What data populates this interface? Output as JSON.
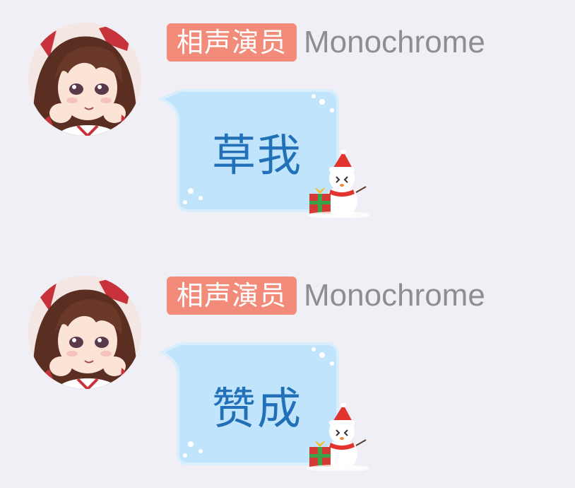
{
  "theme": {
    "background": "#efeff5",
    "badge_color": "#f28b79",
    "bubble_fill": "#bfe4fb",
    "bubble_stroke": "#d8eefc",
    "text_color": "#2271b8",
    "name_color": "#8d8e94"
  },
  "messages": [
    {
      "sender_title": "相声演员",
      "sender_name": "Monochrome",
      "text": "草我",
      "avatar_icon": "anime-girl-avatar-icon",
      "bubble_decoration_icon": "snowman-gift-icon"
    },
    {
      "sender_title": "相声演员",
      "sender_name": "Monochrome",
      "text": "赞成",
      "avatar_icon": "anime-girl-avatar-icon",
      "bubble_decoration_icon": "snowman-gift-icon"
    }
  ]
}
